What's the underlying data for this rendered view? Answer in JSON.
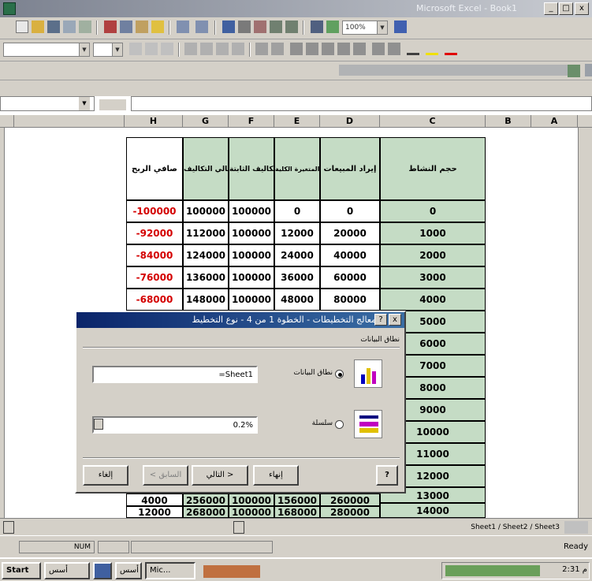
{
  "window": {
    "title": "Microsoft Excel - Book1"
  },
  "formula_bar": {
    "namebox_value": "",
    "formula_value": ""
  },
  "toolbar": {
    "zoom": "100%"
  },
  "grid": {
    "columns": [
      "H",
      "G",
      "F",
      "E",
      "D",
      "C",
      "B",
      "A"
    ],
    "headers": [
      "صافي الربح",
      "إجمالي التكاليف",
      "التكاليف الثابتة",
      "التكاليف المتغيرة الكلية",
      "إيراد المبيعات",
      "حجم النشاط"
    ],
    "rows": [
      [
        "-100000",
        "100000",
        "100000",
        "0",
        "0",
        "0"
      ],
      [
        "-92000",
        "112000",
        "100000",
        "12000",
        "20000",
        "1000"
      ],
      [
        "-84000",
        "124000",
        "100000",
        "24000",
        "40000",
        "2000"
      ],
      [
        "-76000",
        "136000",
        "100000",
        "36000",
        "60000",
        "3000"
      ],
      [
        "-68000",
        "148000",
        "100000",
        "48000",
        "80000",
        "4000"
      ]
    ],
    "visible_c_values": [
      "5000",
      "6000",
      "7000",
      "8000",
      "9000",
      "10000",
      "11000",
      "12000",
      "13000",
      "14000"
    ],
    "bottom_rows": [
      [
        "4000",
        "256000",
        "100000",
        "156000",
        "260000"
      ],
      [
        "12000",
        "268000",
        "100000",
        "168000",
        "280000"
      ]
    ]
  },
  "dialog": {
    "title": "معالج التخطيطات - الخطوة 1 من 4 - نوع التخطيط",
    "section_label": "نطاق البيانات",
    "option1_label": "نطاق البيانات",
    "option1_value": "=Sheet1",
    "option2_label": "سلسلة",
    "option2_value": "0.2%",
    "buttons": {
      "help": "?",
      "finish": "إنهاء",
      "next": "التالي >",
      "back": "< السابق",
      "cancel": "إلغاء"
    }
  },
  "status": {
    "left": "Ready",
    "right": "NUM"
  },
  "sheet_tabs": {
    "label": "Sheet1 / Sheet2 / Sheet3"
  },
  "taskbar": {
    "start_label": "Start",
    "items": [
      "أسس",
      "Mic..."
    ],
    "clock": "2:31 م"
  },
  "colors": {
    "green_cell": "#c5dcc5",
    "negative": "#d40000",
    "dialog_title": "#0a246a"
  }
}
